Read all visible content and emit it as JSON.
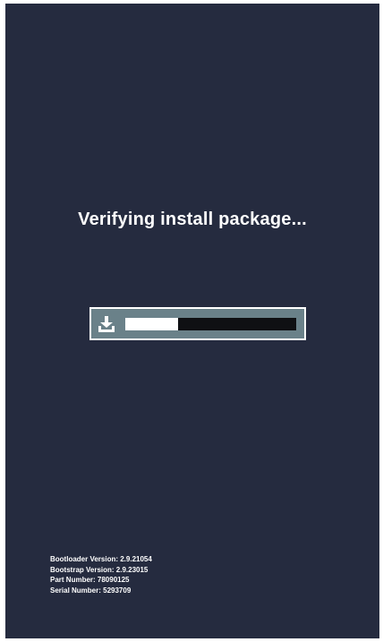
{
  "screen": {
    "background_color": "#252b3f",
    "status_text": "Verifying install package..."
  },
  "progress": {
    "icon": "download-icon",
    "fraction": 0.31,
    "frame_color": "#6a8189",
    "fill_color": "#ffffff",
    "track_color": "#0f1013"
  },
  "device_info": {
    "bootloader": "Bootloader Version: 2.9.21054",
    "bootstrap": "Bootstrap Version: 2.9.23015",
    "part_number": "Part Number: 78090125",
    "serial_number": "Serial Number: 5293709"
  }
}
